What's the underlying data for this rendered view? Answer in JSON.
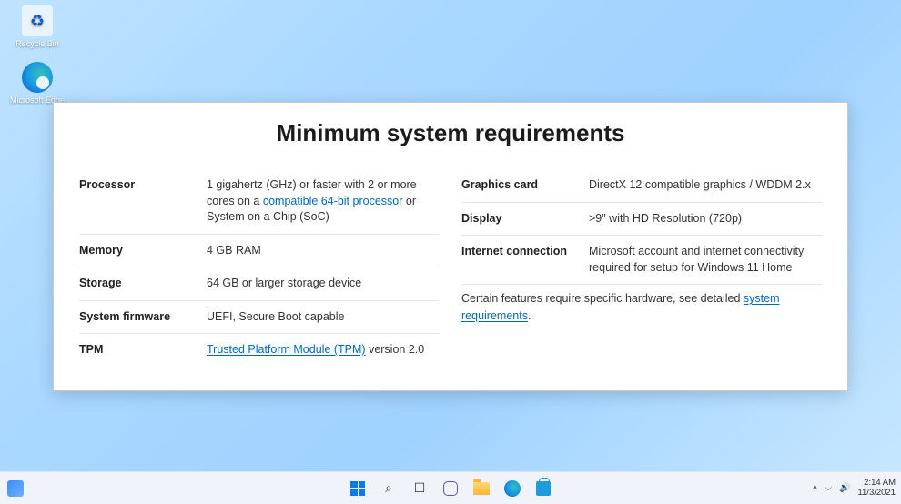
{
  "desktop": {
    "icons": {
      "recycle_bin": "Recycle Bin",
      "edge": "Microsoft Edge"
    }
  },
  "panel": {
    "title": "Minimum system requirements",
    "left": [
      {
        "label": "Processor",
        "value_pre": "1 gigahertz (GHz) or faster with 2 or more cores on a ",
        "link": "compatible 64-bit processor",
        "value_post": " or System on a Chip (SoC)"
      },
      {
        "label": "Memory",
        "value": "4 GB RAM"
      },
      {
        "label": "Storage",
        "value": "64 GB or larger storage device"
      },
      {
        "label": "System firmware",
        "value": "UEFI, Secure Boot capable"
      },
      {
        "label": "TPM",
        "link": "Trusted Platform Module (TPM)",
        "value_post": " version 2.0"
      }
    ],
    "right": [
      {
        "label": "Graphics card",
        "value": "DirectX 12 compatible graphics / WDDM 2.x"
      },
      {
        "label": "Display",
        "value": ">9\" with HD Resolution (720p)"
      },
      {
        "label": "Internet connection",
        "value": "Microsoft account and internet connectivity required for setup for Windows 11 Home"
      }
    ],
    "footnote_pre": "Certain features require specific hardware, see detailed ",
    "footnote_link": "system requirements",
    "footnote_post": "."
  },
  "taskbar": {
    "time": "2:14 AM",
    "date": "11/3/2021"
  }
}
